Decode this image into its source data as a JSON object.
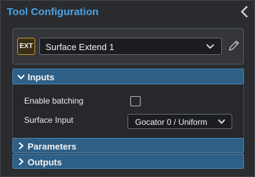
{
  "header": {
    "title": "Tool Configuration"
  },
  "tool": {
    "badge": "EXT",
    "selected": "Surface Extend 1"
  },
  "sections": {
    "inputs": {
      "label": "Inputs",
      "expanded": true,
      "fields": {
        "enable_batching": {
          "label": "Enable batching",
          "checked": false
        },
        "surface_input": {
          "label": "Surface Input",
          "value": "Gocator 0 / Uniform"
        }
      }
    },
    "parameters": {
      "label": "Parameters",
      "expanded": false
    },
    "outputs": {
      "label": "Outputs",
      "expanded": false
    }
  },
  "colors": {
    "title": "#4aa3e6",
    "section_header": "#2e5f86",
    "badge_border": "#c89a2c"
  }
}
